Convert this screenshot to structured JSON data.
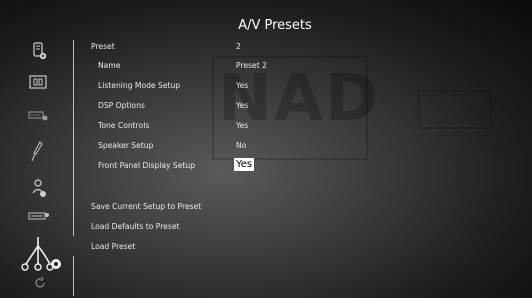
{
  "header": {
    "title": "A/V Presets"
  },
  "preset": {
    "label": "Preset",
    "value": "2"
  },
  "rows": [
    {
      "label": "Name",
      "value": "Preset 2"
    },
    {
      "label": "Listening Mode Setup",
      "value": "Yes"
    },
    {
      "label": "DSP Options",
      "value": "Yes"
    },
    {
      "label": "Tone Controls",
      "value": "Yes"
    },
    {
      "label": "Speaker Setup",
      "value": "No"
    },
    {
      "label": "Front Panel Display Setup",
      "value": "Yes"
    }
  ],
  "actions": [
    "Save Current Setup to Preset",
    "Load Defaults to Preset",
    "Load Preset"
  ],
  "background_logo": "NAD",
  "sidebar_icons": [
    "device-settings-icon",
    "speaker-grid-icon",
    "input-settings-icon",
    "audio-cable-icon",
    "person-settings-icon",
    "display-settings-icon",
    "av-cables-preset-icon",
    "refresh-icon"
  ],
  "colors": {
    "accent": "#ffffff",
    "text": "#eaeaea",
    "selected_bg": "#ffffff"
  }
}
